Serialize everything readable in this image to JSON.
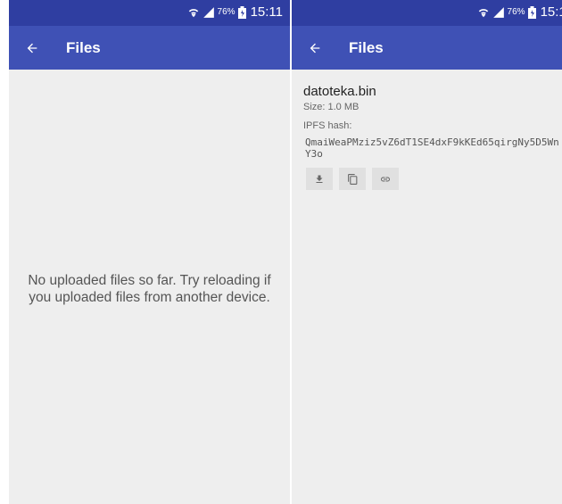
{
  "status_bar": {
    "battery": "76%",
    "time": "15:11"
  },
  "appbar": {
    "title": "Files"
  },
  "empty_state": {
    "line1": "No uploaded files so far. Try reloading if",
    "line2": "you uploaded files from another device."
  },
  "file": {
    "name": "datoteka.bin",
    "size": "Size: 1.0 MB",
    "hash_label": "IPFS hash:",
    "hash": "QmaiWeaPMziz5vZ6dT1SE4dxF9kKEd65qirgNy5D5WnY3o"
  },
  "actions": [
    "download-icon",
    "copy-icon",
    "link-icon"
  ],
  "colors": {
    "status_bar": "#2f3ea1",
    "app_bar": "#3f51b5",
    "background": "#eeeeee"
  }
}
